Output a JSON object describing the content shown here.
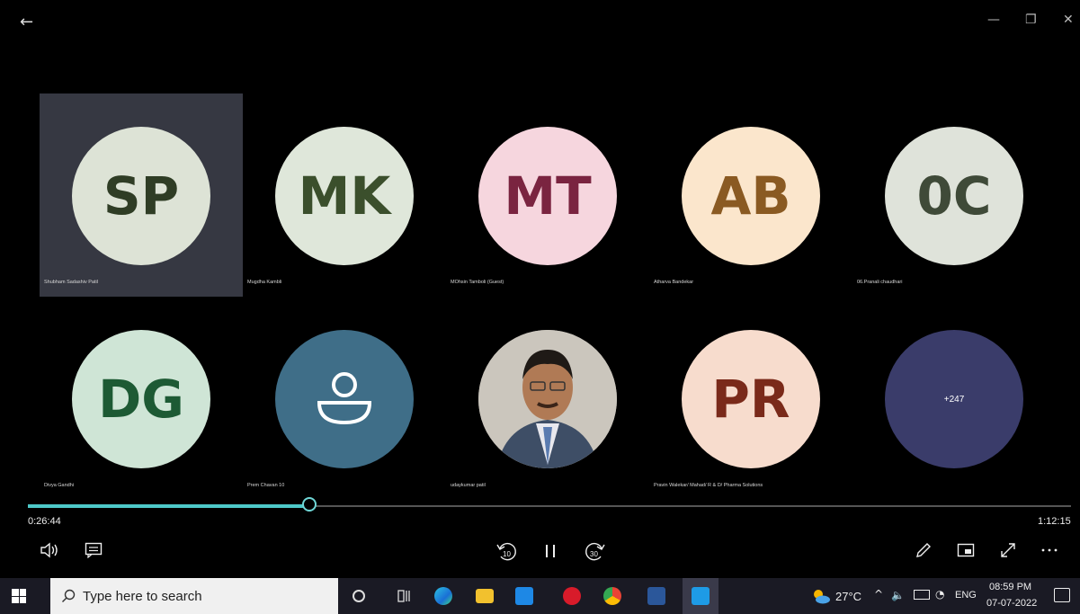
{
  "titlebar": {
    "back_icon": "←",
    "minimize": "—",
    "restore": "❐",
    "close": "✕"
  },
  "participants": [
    {
      "initials": "SP",
      "name": "Shubham Sadashiv Patil",
      "bg": "#dde3d6",
      "fg": "#2f3d25"
    },
    {
      "initials": "MK",
      "name": "Mugdha Kambli",
      "bg": "#dfe7da",
      "fg": "#3b4f2c"
    },
    {
      "initials": "MT",
      "name": "MOhsin Tamboli (Guest)",
      "bg": "#f6d6de",
      "fg": "#7a2440"
    },
    {
      "initials": "AB",
      "name": "Atharva Bandekar",
      "bg": "#fbe6cc",
      "fg": "#8a5a22"
    },
    {
      "initials": "0C",
      "name": "06.Pranali chaudhari",
      "bg": "#dfe3da",
      "fg": "#3f4a38"
    },
    {
      "initials": "DG",
      "name": "Divya Gandhi",
      "bg": "#cfe5d6",
      "fg": "#1d5a34"
    },
    {
      "initials": "",
      "name": "Prem Chavan 10",
      "bg": "#3f6e88",
      "fg": "#ffffff"
    },
    {
      "initials": "",
      "name": "udaykumar patil",
      "bg": "#cfcac2",
      "fg": "#000000"
    },
    {
      "initials": "PR",
      "name": "Pravin Walekar/ Mahad/ R & D/ Pharma Solutions",
      "bg": "#f7dccd",
      "fg": "#7a2a1a"
    },
    {
      "initials": "+247",
      "name": "",
      "bg": "#3a3c6a",
      "fg": "#ffffff"
    }
  ],
  "player": {
    "current_time": "0:26:44",
    "total_time": "1:12:15",
    "progress_fraction": 0.27,
    "skip_back_label": "10",
    "skip_forward_label": "30"
  },
  "taskbar": {
    "search_placeholder": "Type here to search",
    "weather": "27°C",
    "lang": "ENG",
    "time": "08:59 PM",
    "date": "07-07-2022"
  },
  "colors": {
    "accent": "#4dc8c8",
    "selected_tile": "#363842"
  }
}
